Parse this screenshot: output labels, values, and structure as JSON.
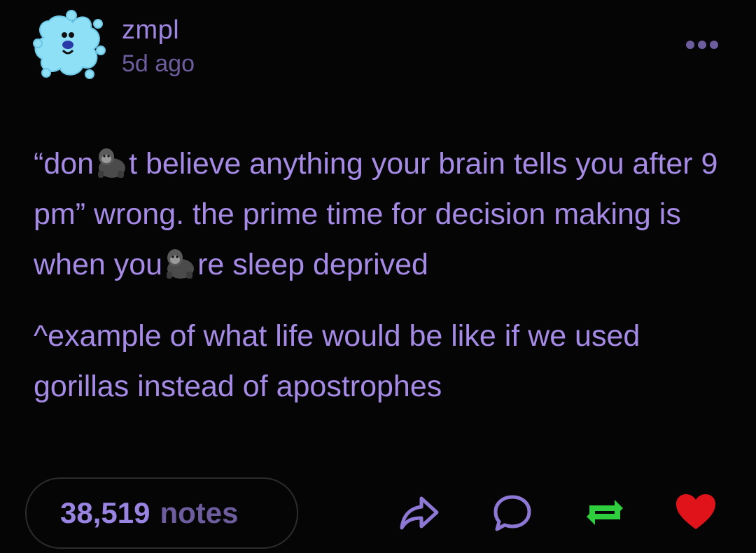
{
  "post": {
    "username": "zmpl",
    "timestamp": "5d ago",
    "text": {
      "line1_part1": "“don",
      "line1_part2": "t believe anything your brain tells you after 9 pm” wrong. the prime time for decision making is when you",
      "line1_part3": "re sleep deprived",
      "line2": "^example of what life would be like if we used gorillas instead of apostrophes"
    },
    "emoji": "gorilla",
    "notes": {
      "count": "38,519",
      "label": "notes"
    },
    "icons": {
      "more": "more-dots-icon",
      "share": "share-icon",
      "reply": "reply-icon",
      "reblog": "reblog-icon",
      "like": "heart-icon"
    },
    "colors": {
      "background": "#050505",
      "text": "#a58ae6",
      "muted": "#6e5d9e",
      "reblog": "#2fce3e",
      "like": "#e0131b",
      "avatar": "#8ee0f7"
    }
  }
}
